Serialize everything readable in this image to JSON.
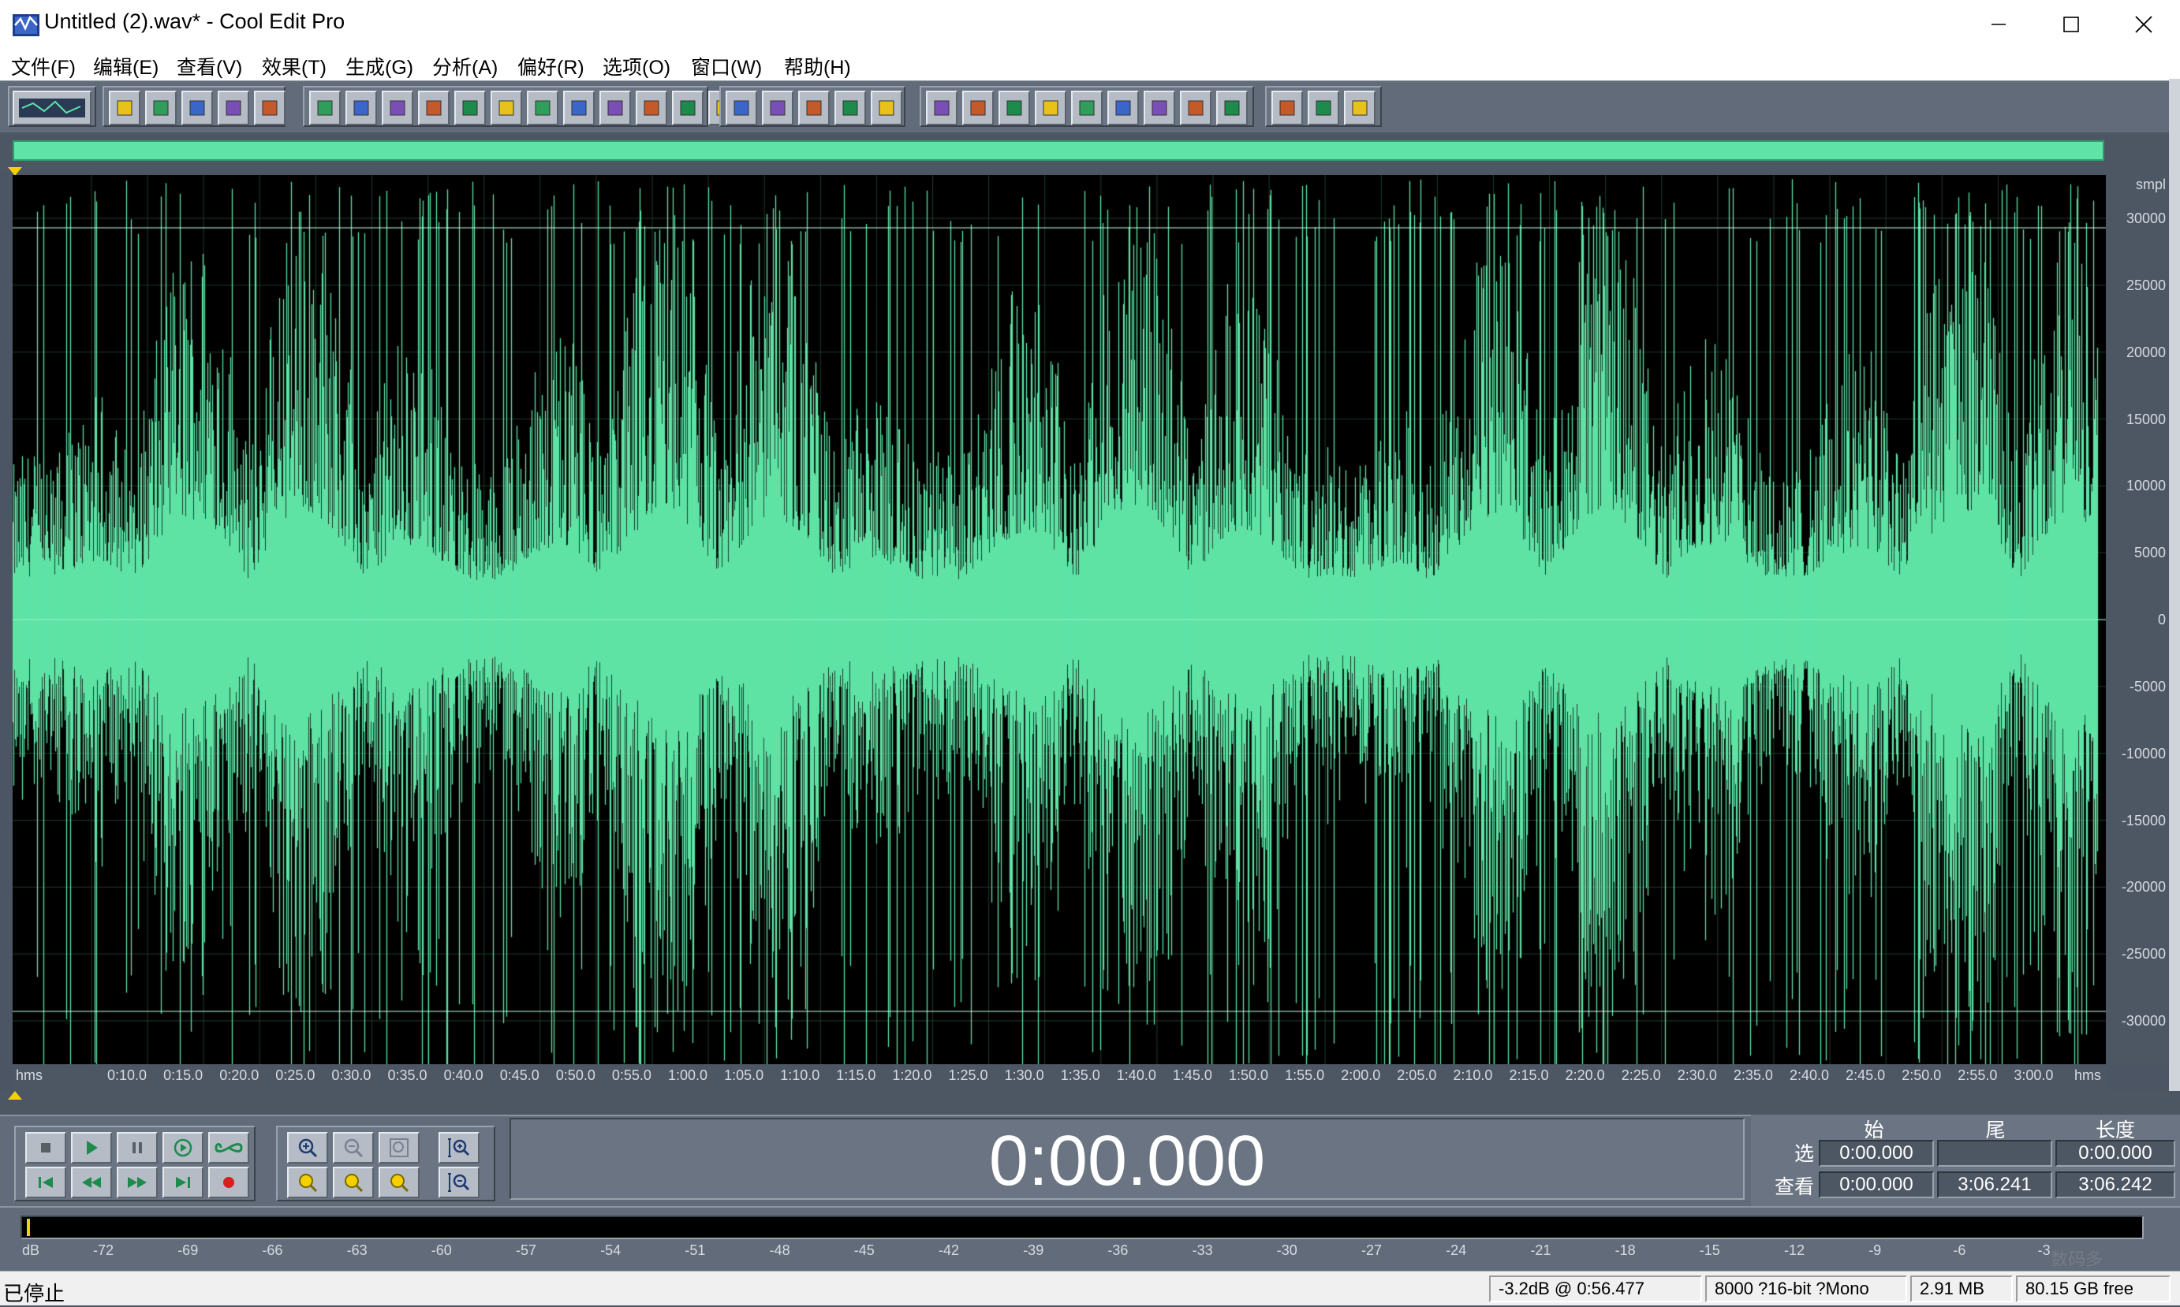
{
  "window": {
    "title": "Untitled (2).wav* - Cool Edit Pro"
  },
  "menu": [
    "文件(F)",
    "编辑(E)",
    "查看(V)",
    "效果(T)",
    "生成(G)",
    "分析(A)",
    "偏好(R)",
    "选项(O)",
    "窗口(W)",
    "帮助(H)"
  ],
  "toolbar": {
    "groups": [
      [
        "multitrack-toggle"
      ],
      [
        "new-file",
        "open-file",
        "save-file",
        "save-all",
        "close-file"
      ],
      [
        "undo",
        "redo",
        "repeat-last",
        "copy-new",
        "copy",
        "cut",
        "paste",
        "paste-mix",
        "trim",
        "silence",
        "mix-paste",
        "convert"
      ],
      [
        "envelope",
        "stretch",
        "channel-mixer",
        "amplify",
        "normalize"
      ],
      [
        "display-waveform",
        "spectral-view",
        "cue-list",
        "play-list",
        "zoom-window",
        "time-window",
        "status-window",
        "level-meter",
        "info-panel"
      ],
      [
        "settings",
        "tools",
        "help"
      ]
    ]
  },
  "waveform": {
    "color": "#5fe3a6",
    "background": "#000000",
    "y_unit": "smpl",
    "y_ticks": [
      "30000",
      "25000",
      "20000",
      "15000",
      "10000",
      "5000",
      "0",
      "-5000",
      "-10000",
      "-15000",
      "-20000",
      "-25000",
      "-30000"
    ],
    "x_unit": "hms",
    "x_ticks": [
      "0:10.0",
      "0:15.0",
      "0:20.0",
      "0:25.0",
      "0:30.0",
      "0:35.0",
      "0:40.0",
      "0:45.0",
      "0:50.0",
      "0:55.0",
      "1:00.0",
      "1:05.0",
      "1:10.0",
      "1:15.0",
      "1:20.0",
      "1:25.0",
      "1:30.0",
      "1:35.0",
      "1:40.0",
      "1:45.0",
      "1:50.0",
      "1:55.0",
      "2:00.0",
      "2:05.0",
      "2:10.0",
      "2:15.0",
      "2:20.0",
      "2:25.0",
      "2:30.0",
      "2:35.0",
      "2:40.0",
      "2:45.0",
      "2:50.0",
      "2:55.0",
      "3:00.0"
    ],
    "x_unit_right": "hms"
  },
  "transport": {
    "time": "0:00.000"
  },
  "selection": {
    "headers": {
      "start": "始",
      "end": "尾",
      "length": "长度"
    },
    "rows": [
      {
        "label": "选",
        "start": "0:00.000",
        "end": "",
        "length": "0:00.000"
      },
      {
        "label": "查看",
        "start": "0:00.000",
        "end": "3:06.241",
        "length": "3:06.242"
      }
    ]
  },
  "meter": {
    "ticks": [
      "dB",
      "-72",
      "-69",
      "-66",
      "-63",
      "-60",
      "-57",
      "-54",
      "-51",
      "-48",
      "-45",
      "-42",
      "-39",
      "-36",
      "-33",
      "-30",
      "-27",
      "-24",
      "-21",
      "-18",
      "-15",
      "-12",
      "-9",
      "-6",
      "-3"
    ]
  },
  "status": {
    "state": "已停止",
    "level": "-3.2dB @  0:56.477",
    "format": "8000 ?16-bit ?Mono",
    "size": "2.91 MB",
    "free": "80.15 GB free"
  },
  "watermark": "数码多"
}
